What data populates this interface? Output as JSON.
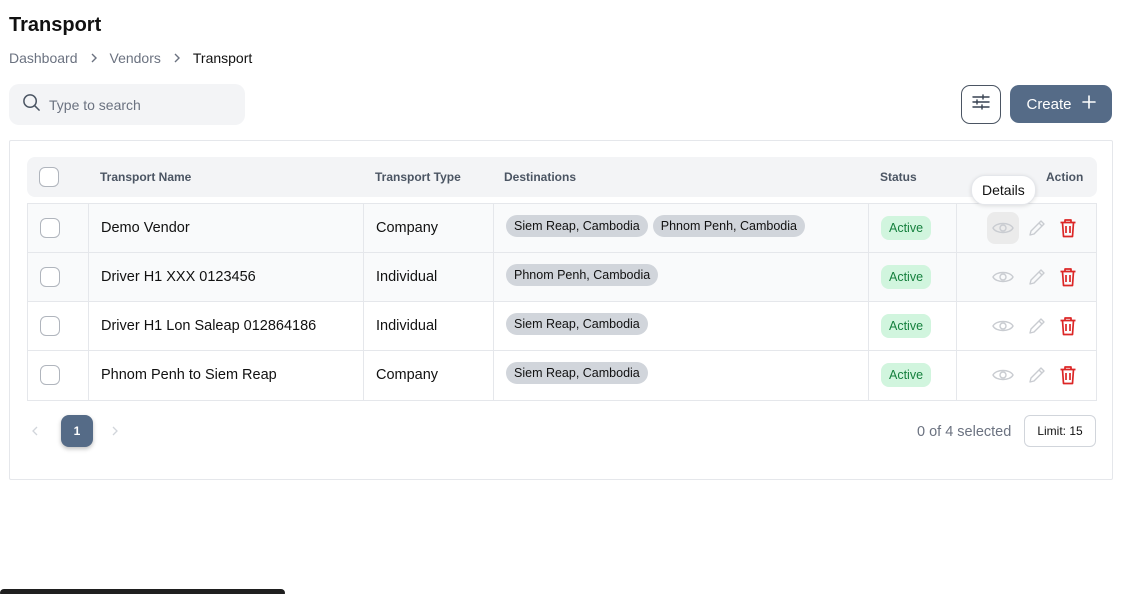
{
  "page": {
    "title": "Transport"
  },
  "breadcrumb": [
    "Dashboard",
    "Vendors",
    "Transport"
  ],
  "search": {
    "placeholder": "Type to search",
    "value": ""
  },
  "toolbar": {
    "create_label": "Create"
  },
  "table": {
    "columns": {
      "name": "Transport Name",
      "type": "Transport Type",
      "destinations": "Destinations",
      "status": "Status",
      "action": "Action"
    },
    "rows": [
      {
        "name": "Demo Vendor",
        "type": "Company",
        "destinations": [
          "Siem Reap, Cambodia",
          "Phnom Penh, Cambodia"
        ],
        "status": "Active"
      },
      {
        "name": "Driver H1 XXX 0123456",
        "type": "Individual",
        "destinations": [
          "Phnom Penh, Cambodia"
        ],
        "status": "Active"
      },
      {
        "name": "Driver H1 Lon Saleap 012864186",
        "type": "Individual",
        "destinations": [
          "Siem Reap, Cambodia"
        ],
        "status": "Active"
      },
      {
        "name": "Phnom Penh to Siem Reap",
        "type": "Company",
        "destinations": [
          "Siem Reap, Cambodia"
        ],
        "status": "Active"
      }
    ]
  },
  "tooltip": {
    "text": "Details"
  },
  "pagination": {
    "current_page": "1",
    "selected_text": "0 of 4 selected",
    "limit_label": "Limit: 15"
  },
  "colors": {
    "primary": "#556b87",
    "status_bg": "#d1f5de",
    "status_text": "#15803d",
    "delete": "#dc2626"
  },
  "icons": {
    "search": "search-icon",
    "filter": "sliders-icon",
    "create": "plus-icon",
    "view": "eye-icon",
    "edit": "pencil-icon",
    "delete": "trash-icon"
  }
}
